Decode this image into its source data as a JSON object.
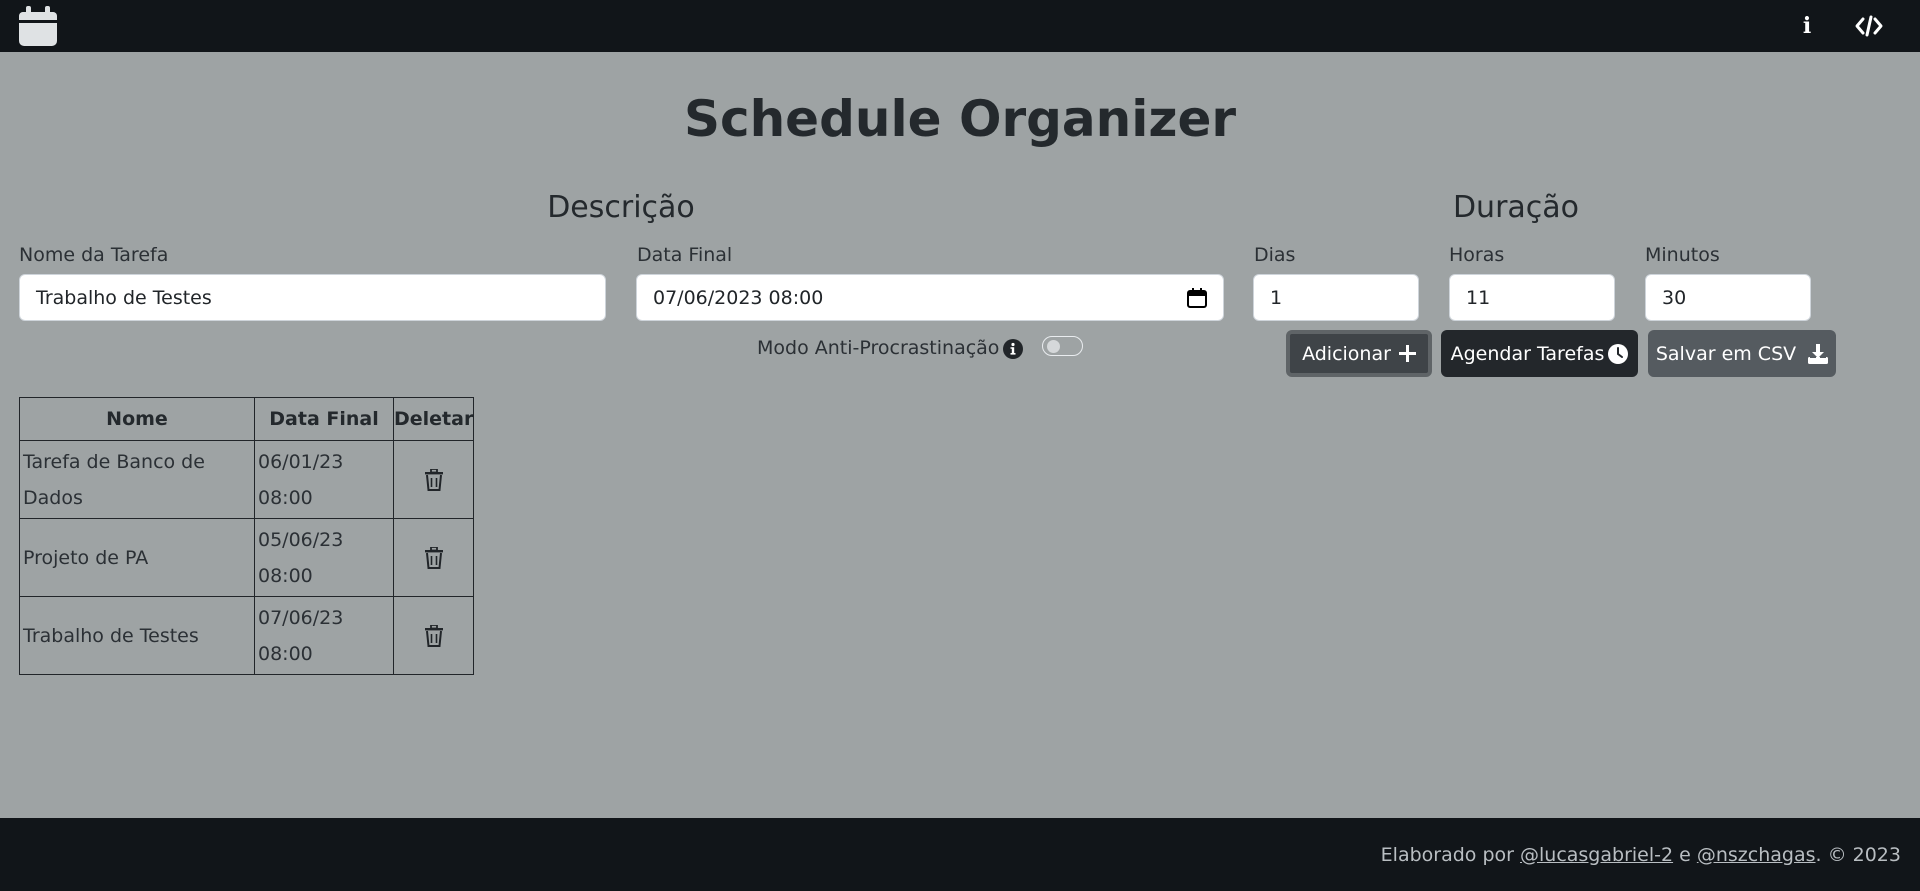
{
  "app": {
    "title": "Schedule Organizer",
    "accent": "#111519",
    "background": "#9ea3a4"
  },
  "navbar": {
    "logo_icon": "calendar-icon",
    "info_label": "i",
    "code_icon": "code-icon"
  },
  "sections": {
    "description_title": "Descrição",
    "duration_title": "Duração"
  },
  "form": {
    "task_name": {
      "label": "Nome da Tarefa",
      "value": "Trabalho de Testes"
    },
    "end_date": {
      "label": "Data Final",
      "value": "07/06/2023 08:00"
    },
    "days": {
      "label": "Dias",
      "value": "1"
    },
    "hours": {
      "label": "Horas",
      "value": "11"
    },
    "minutes": {
      "label": "Minutos",
      "value": "30"
    },
    "anti_procrastination": {
      "label": "Modo Anti-Procrastinação",
      "enabled": false
    }
  },
  "buttons": {
    "add": "Adicionar",
    "schedule": "Agendar Tarefas",
    "csv": "Salvar em CSV"
  },
  "table": {
    "headers": [
      "Nome",
      "Data Final",
      "Deletar"
    ],
    "rows": [
      {
        "name": "Tarefa de Banco de Dados",
        "date": "06/01/23 08:00"
      },
      {
        "name": "Projeto de PA",
        "date": "05/06/23 08:00"
      },
      {
        "name": "Trabalho de Testes",
        "date": "07/06/23 08:00"
      }
    ]
  },
  "footer": {
    "prefix": "Elaborado por ",
    "author1": "@lucasgabriel-2",
    "and": " e ",
    "author2": "@nszchagas",
    "suffix": ". © 2023"
  }
}
